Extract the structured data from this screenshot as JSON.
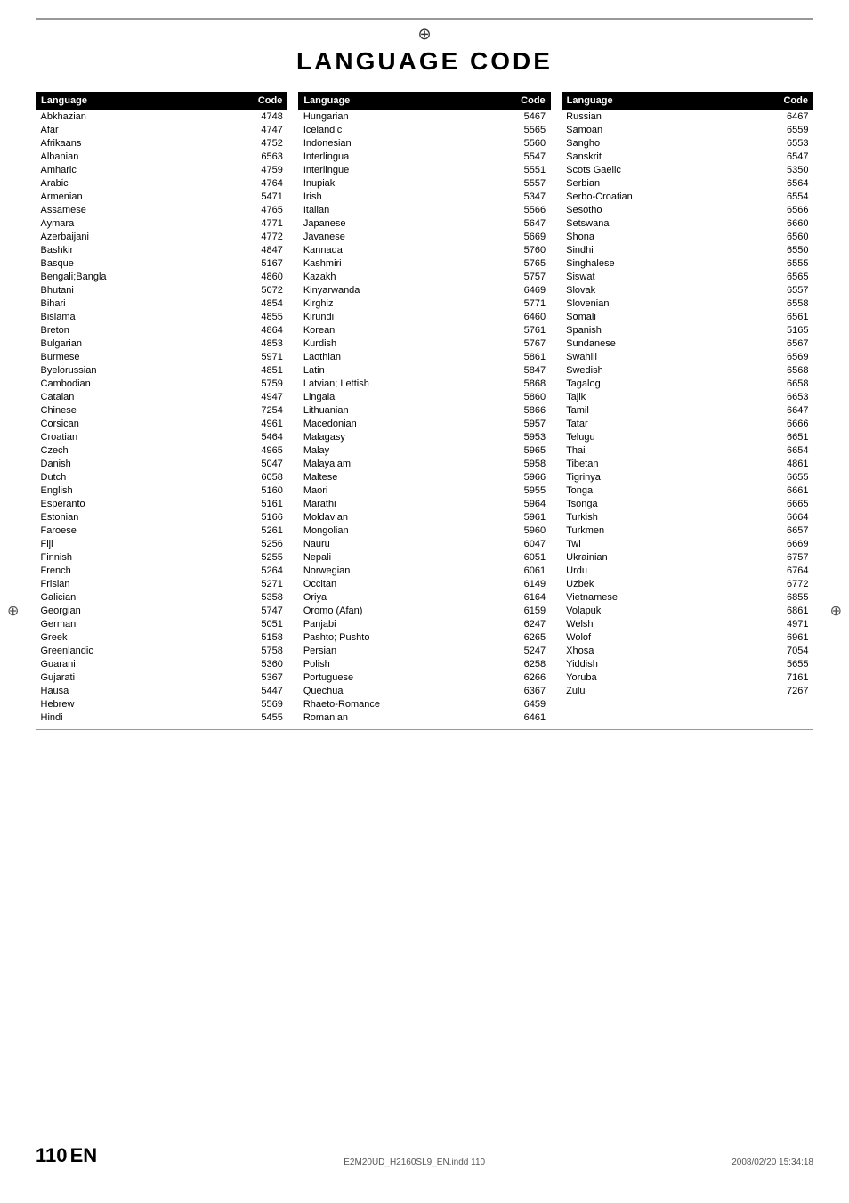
{
  "page": {
    "top_symbol": "⊕",
    "title": "LANGUAGE CODE",
    "footer": {
      "page_number": "110",
      "lang": "EN",
      "center_text": "E2M20UD_H2160SL9_EN.indd  110",
      "right_text": "2008/02/20  15:34:18"
    }
  },
  "col1": {
    "headers": [
      "Language",
      "Code"
    ],
    "rows": [
      [
        "Abkhazian",
        "4748"
      ],
      [
        "Afar",
        "4747"
      ],
      [
        "Afrikaans",
        "4752"
      ],
      [
        "Albanian",
        "6563"
      ],
      [
        "Amharic",
        "4759"
      ],
      [
        "Arabic",
        "4764"
      ],
      [
        "Armenian",
        "5471"
      ],
      [
        "Assamese",
        "4765"
      ],
      [
        "Aymara",
        "4771"
      ],
      [
        "Azerbaijani",
        "4772"
      ],
      [
        "Bashkir",
        "4847"
      ],
      [
        "Basque",
        "5167"
      ],
      [
        "Bengali;Bangla",
        "4860"
      ],
      [
        "Bhutani",
        "5072"
      ],
      [
        "Bihari",
        "4854"
      ],
      [
        "Bislama",
        "4855"
      ],
      [
        "Breton",
        "4864"
      ],
      [
        "Bulgarian",
        "4853"
      ],
      [
        "Burmese",
        "5971"
      ],
      [
        "Byelorussian",
        "4851"
      ],
      [
        "Cambodian",
        "5759"
      ],
      [
        "Catalan",
        "4947"
      ],
      [
        "Chinese",
        "7254"
      ],
      [
        "Corsican",
        "4961"
      ],
      [
        "Croatian",
        "5464"
      ],
      [
        "Czech",
        "4965"
      ],
      [
        "Danish",
        "5047"
      ],
      [
        "Dutch",
        "6058"
      ],
      [
        "English",
        "5160"
      ],
      [
        "Esperanto",
        "5161"
      ],
      [
        "Estonian",
        "5166"
      ],
      [
        "Faroese",
        "5261"
      ],
      [
        "Fiji",
        "5256"
      ],
      [
        "Finnish",
        "5255"
      ],
      [
        "French",
        "5264"
      ],
      [
        "Frisian",
        "5271"
      ],
      [
        "Galician",
        "5358"
      ],
      [
        "Georgian",
        "5747"
      ],
      [
        "German",
        "5051"
      ],
      [
        "Greek",
        "5158"
      ],
      [
        "Greenlandic",
        "5758"
      ],
      [
        "Guarani",
        "5360"
      ],
      [
        "Gujarati",
        "5367"
      ],
      [
        "Hausa",
        "5447"
      ],
      [
        "Hebrew",
        "5569"
      ],
      [
        "Hindi",
        "5455"
      ]
    ]
  },
  "col2": {
    "headers": [
      "Language",
      "Code"
    ],
    "rows": [
      [
        "Hungarian",
        "5467"
      ],
      [
        "Icelandic",
        "5565"
      ],
      [
        "Indonesian",
        "5560"
      ],
      [
        "Interlingua",
        "5547"
      ],
      [
        "Interlingue",
        "5551"
      ],
      [
        "Inupiak",
        "5557"
      ],
      [
        "Irish",
        "5347"
      ],
      [
        "Italian",
        "5566"
      ],
      [
        "Japanese",
        "5647"
      ],
      [
        "Javanese",
        "5669"
      ],
      [
        "Kannada",
        "5760"
      ],
      [
        "Kashmiri",
        "5765"
      ],
      [
        "Kazakh",
        "5757"
      ],
      [
        "Kinyarwanda",
        "6469"
      ],
      [
        "Kirghiz",
        "5771"
      ],
      [
        "Kirundi",
        "6460"
      ],
      [
        "Korean",
        "5761"
      ],
      [
        "Kurdish",
        "5767"
      ],
      [
        "Laothian",
        "5861"
      ],
      [
        "Latin",
        "5847"
      ],
      [
        "Latvian; Lettish",
        "5868"
      ],
      [
        "Lingala",
        "5860"
      ],
      [
        "Lithuanian",
        "5866"
      ],
      [
        "Macedonian",
        "5957"
      ],
      [
        "Malagasy",
        "5953"
      ],
      [
        "Malay",
        "5965"
      ],
      [
        "Malayalam",
        "5958"
      ],
      [
        "Maltese",
        "5966"
      ],
      [
        "Maori",
        "5955"
      ],
      [
        "Marathi",
        "5964"
      ],
      [
        "Moldavian",
        "5961"
      ],
      [
        "Mongolian",
        "5960"
      ],
      [
        "Nauru",
        "6047"
      ],
      [
        "Nepali",
        "6051"
      ],
      [
        "Norwegian",
        "6061"
      ],
      [
        "Occitan",
        "6149"
      ],
      [
        "Oriya",
        "6164"
      ],
      [
        "Oromo (Afan)",
        "6159"
      ],
      [
        "Panjabi",
        "6247"
      ],
      [
        "Pashto; Pushto",
        "6265"
      ],
      [
        "Persian",
        "5247"
      ],
      [
        "Polish",
        "6258"
      ],
      [
        "Portuguese",
        "6266"
      ],
      [
        "Quechua",
        "6367"
      ],
      [
        "Rhaeto-Romance",
        "6459"
      ],
      [
        "Romanian",
        "6461"
      ]
    ]
  },
  "col3": {
    "headers": [
      "Language",
      "Code"
    ],
    "rows": [
      [
        "Russian",
        "6467"
      ],
      [
        "Samoan",
        "6559"
      ],
      [
        "Sangho",
        "6553"
      ],
      [
        "Sanskrit",
        "6547"
      ],
      [
        "Scots Gaelic",
        "5350"
      ],
      [
        "Serbian",
        "6564"
      ],
      [
        "Serbo-Croatian",
        "6554"
      ],
      [
        "Sesotho",
        "6566"
      ],
      [
        "Setswana",
        "6660"
      ],
      [
        "Shona",
        "6560"
      ],
      [
        "Sindhi",
        "6550"
      ],
      [
        "Singhalese",
        "6555"
      ],
      [
        "Siswat",
        "6565"
      ],
      [
        "Slovak",
        "6557"
      ],
      [
        "Slovenian",
        "6558"
      ],
      [
        "Somali",
        "6561"
      ],
      [
        "Spanish",
        "5165"
      ],
      [
        "Sundanese",
        "6567"
      ],
      [
        "Swahili",
        "6569"
      ],
      [
        "Swedish",
        "6568"
      ],
      [
        "Tagalog",
        "6658"
      ],
      [
        "Tajik",
        "6653"
      ],
      [
        "Tamil",
        "6647"
      ],
      [
        "Tatar",
        "6666"
      ],
      [
        "Telugu",
        "6651"
      ],
      [
        "Thai",
        "6654"
      ],
      [
        "Tibetan",
        "4861"
      ],
      [
        "Tigrinya",
        "6655"
      ],
      [
        "Tonga",
        "6661"
      ],
      [
        "Tsonga",
        "6665"
      ],
      [
        "Turkish",
        "6664"
      ],
      [
        "Turkmen",
        "6657"
      ],
      [
        "Twi",
        "6669"
      ],
      [
        "Ukrainian",
        "6757"
      ],
      [
        "Urdu",
        "6764"
      ],
      [
        "Uzbek",
        "6772"
      ],
      [
        "Vietnamese",
        "6855"
      ],
      [
        "Volapuk",
        "6861"
      ],
      [
        "Welsh",
        "4971"
      ],
      [
        "Wolof",
        "6961"
      ],
      [
        "Xhosa",
        "7054"
      ],
      [
        "Yiddish",
        "5655"
      ],
      [
        "Yoruba",
        "7161"
      ],
      [
        "Zulu",
        "7267"
      ]
    ]
  }
}
